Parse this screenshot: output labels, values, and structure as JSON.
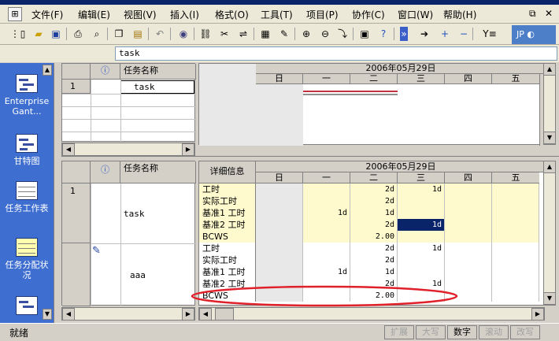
{
  "menu": [
    "文件(F)",
    "编辑(E)",
    "视图(V)",
    "插入(I)",
    "格式(O)",
    "工具(T)",
    "项目(P)",
    "协作(C)",
    "窗口(W)",
    "帮助(H)"
  ],
  "entry_value": "task",
  "viewbar": [
    {
      "label": "Enterprise Gant...",
      "icon": "enterprise-gantt-icon"
    },
    {
      "label": "甘特图",
      "icon": "gantt-chart-icon"
    },
    {
      "label": "任务工作表",
      "icon": "task-sheet-icon"
    },
    {
      "label": "任务分配状况",
      "icon": "task-usage-icon"
    }
  ],
  "top_table": {
    "col_name": "任务名称",
    "rows": [
      {
        "id": "1",
        "name": "task"
      }
    ]
  },
  "timescale": {
    "week": "2006年05月29日",
    "days": [
      "日",
      "一",
      "二",
      "三",
      "四",
      "五"
    ]
  },
  "bottom_table": {
    "col_name": "任务名称",
    "detail_header": "详细信息",
    "rows": [
      {
        "id": "1",
        "name": "task"
      },
      {
        "id": "",
        "name": "aaa"
      }
    ]
  },
  "detail_rows": [
    {
      "label": "工时",
      "values": [
        "",
        "",
        "2d",
        "1d",
        "",
        ""
      ]
    },
    {
      "label": "实际工时",
      "values": [
        "",
        "",
        "2d",
        "",
        "",
        ""
      ]
    },
    {
      "label": "基准1 工时",
      "values": [
        "",
        "1d",
        "1d",
        "",
        "",
        ""
      ]
    },
    {
      "label": "基准2 工时",
      "values": [
        "",
        "",
        "2d",
        "1d",
        "",
        ""
      ]
    },
    {
      "label": "BCWS",
      "values": [
        "",
        "",
        "2.00",
        "",
        "",
        ""
      ]
    },
    {
      "label": "工时",
      "values": [
        "",
        "",
        "2d",
        "1d",
        "",
        ""
      ]
    },
    {
      "label": "实际工时",
      "values": [
        "",
        "",
        "2d",
        "",
        "",
        ""
      ]
    },
    {
      "label": "基准1 工时",
      "values": [
        "",
        "1d",
        "1d",
        "",
        "",
        ""
      ]
    },
    {
      "label": "基准2 工时",
      "values": [
        "",
        "",
        "2d",
        "1d",
        "",
        ""
      ]
    },
    {
      "label": "BCWS",
      "values": [
        "",
        "",
        "2.00",
        "",
        "",
        ""
      ]
    }
  ],
  "status": {
    "ready": "就绪",
    "indicators": [
      "扩展",
      "大写",
      "数字",
      "滚动",
      "改写"
    ]
  },
  "colors": {
    "viewbar": "#3f6ed1",
    "highlight": "#fffacd",
    "selected": "#0a246a",
    "annotation": "#e0202a"
  }
}
